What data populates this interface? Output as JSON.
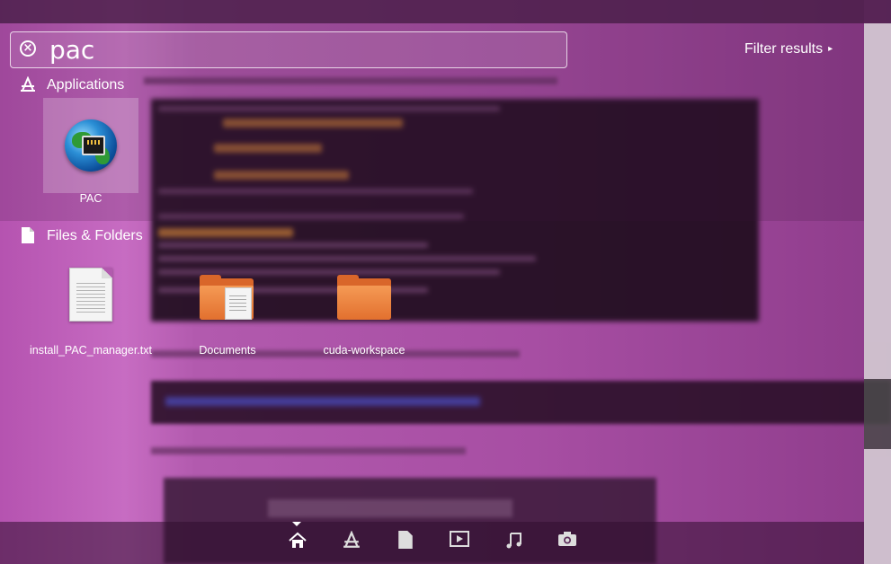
{
  "search": {
    "query": "pac",
    "filter_label": "Filter results"
  },
  "sections": {
    "applications": {
      "title": "Applications",
      "items": [
        {
          "label": "PAC",
          "icon": "network-globe-icon",
          "selected": true
        }
      ]
    },
    "files": {
      "title": "Files & Folders",
      "items": [
        {
          "label": "install_PAC_manager.txt",
          "icon": "text-file-icon"
        },
        {
          "label": "Documents",
          "icon": "documents-folder-icon"
        },
        {
          "label": "cuda-workspace",
          "icon": "folder-icon"
        }
      ]
    }
  },
  "lenses": [
    {
      "name": "home-lens",
      "icon": "home-icon",
      "active": true
    },
    {
      "name": "applications-lens",
      "icon": "applications-icon",
      "active": false
    },
    {
      "name": "files-lens",
      "icon": "files-icon",
      "active": false
    },
    {
      "name": "video-lens",
      "icon": "video-icon",
      "active": false
    },
    {
      "name": "music-lens",
      "icon": "music-icon",
      "active": false
    },
    {
      "name": "photos-lens",
      "icon": "camera-icon",
      "active": false
    }
  ],
  "colors": {
    "overlay_tint": "#b553b0",
    "folder_orange": "#e2702f"
  }
}
